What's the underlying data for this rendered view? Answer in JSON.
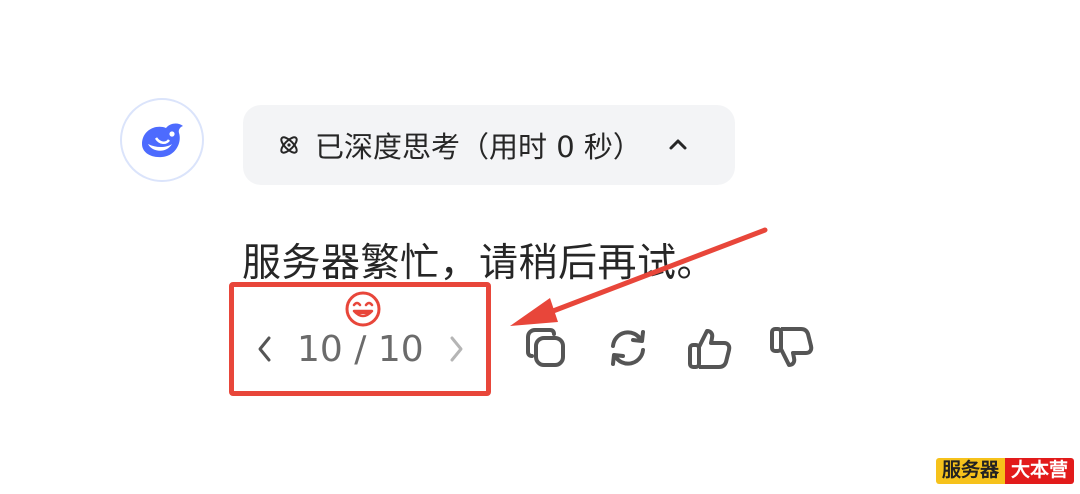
{
  "thinking": {
    "label": "已深度思考（用时 0 秒）"
  },
  "message": {
    "text": "服务器繁忙，请稍后再试。"
  },
  "pager": {
    "text": "10 / 10"
  },
  "icons": {
    "avatar": "deepseek-whale-logo",
    "thinking": "atom-icon",
    "collapse": "chevron-up-icon",
    "prev": "chevron-left-icon",
    "next": "chevron-right-icon",
    "copy": "copy-icon",
    "regenerate": "refresh-icon",
    "like": "thumbs-up-icon",
    "dislike": "thumbs-down-icon",
    "annotation": "smiley-face-icon"
  },
  "colors": {
    "brand_blue": "#4d6bfe",
    "annotation_red": "#e8463a",
    "chip_bg": "#f3f4f6"
  },
  "watermark": {
    "left": "服务器",
    "right": "大本营"
  }
}
